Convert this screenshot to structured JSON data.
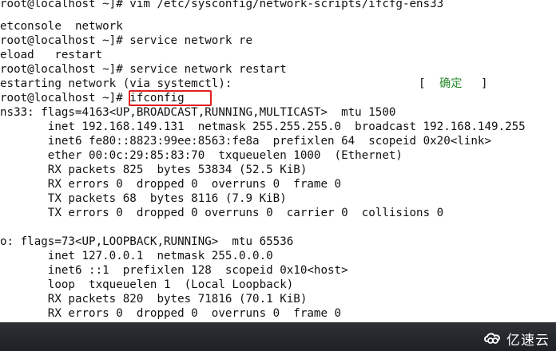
{
  "terminal": {
    "lines": [
      "root@localhost ~]# vim /etc/sysconfig/network-scripts/ifcfg-ens33",
      "etconsole  network",
      "root@localhost ~]# service network re",
      "eload   restart",
      "root@localhost ~]# service network restart",
      "estarting network (via systemctl):",
      "root@localhost ~]# ifconfig",
      "ns33: flags=4163<UP,BROADCAST,RUNNING,MULTICAST>  mtu 1500",
      "       inet 192.168.149.131  netmask 255.255.255.0  broadcast 192.168.149.255",
      "       inet6 fe80::8823:99ee:8563:fe8a  prefixlen 64  scopeid 0x20<link>",
      "       ether 00:0c:29:85:83:70  txqueuelen 1000  (Ethernet)",
      "       RX packets 825  bytes 53834 (52.5 KiB)",
      "       RX errors 0  dropped 0  overruns 0  frame 0",
      "       TX packets 68  bytes 8116 (7.9 KiB)",
      "       TX errors 0  dropped 0 overruns 0  carrier 0  collisions 0",
      "",
      "o: flags=73<UP,LOOPBACK,RUNNING>  mtu 65536",
      "       inet 127.0.0.1  netmask 255.0.0.0",
      "       inet6 ::1  prefixlen 128  scopeid 0x10<host>",
      "       loop  txqueuelen 1  (Local Loopback)",
      "       RX packets 820  bytes 71816 (70.1 KiB)",
      "       RX errors 0  dropped 0  overruns 0  frame 0"
    ],
    "status_open": "[",
    "status_ok": "确定",
    "status_close": "]",
    "highlighted_command": "ifconfig"
  },
  "colors": {
    "highlight_border": "#e02020",
    "ok_text": "#2e8b2e",
    "taskbar_bg": "#1d2024"
  },
  "watermark": {
    "icon": "yisu-cloud-logo-icon",
    "text": "亿速云"
  }
}
